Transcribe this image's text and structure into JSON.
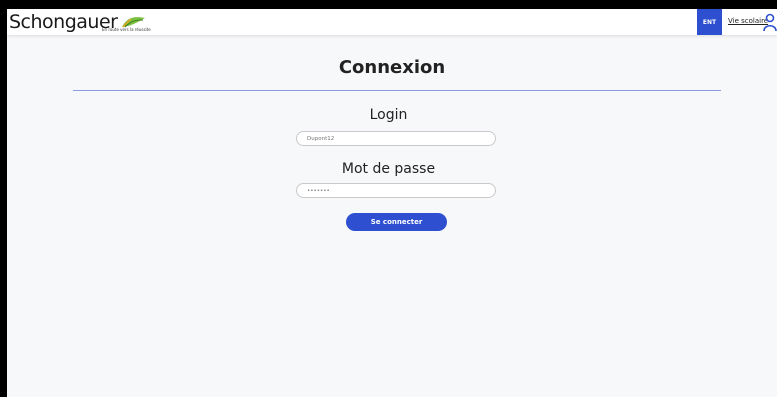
{
  "header": {
    "logo_text": "Schongauer",
    "logo_tagline": "En route vers la réussite",
    "ent_label": "ENT",
    "vie_scolaire_label": "Vie scolaire"
  },
  "main": {
    "title": "Connexion",
    "login_label": "Login",
    "login_placeholder": "Dupont12",
    "password_label": "Mot de passe",
    "password_placeholder": "•••••••",
    "submit_label": "Se connecter"
  },
  "colors": {
    "accent": "#2d4fd0",
    "divider": "#8a9be0",
    "background": "#f7f8fa"
  },
  "icons": [
    "leaf-icon",
    "user-icon"
  ]
}
